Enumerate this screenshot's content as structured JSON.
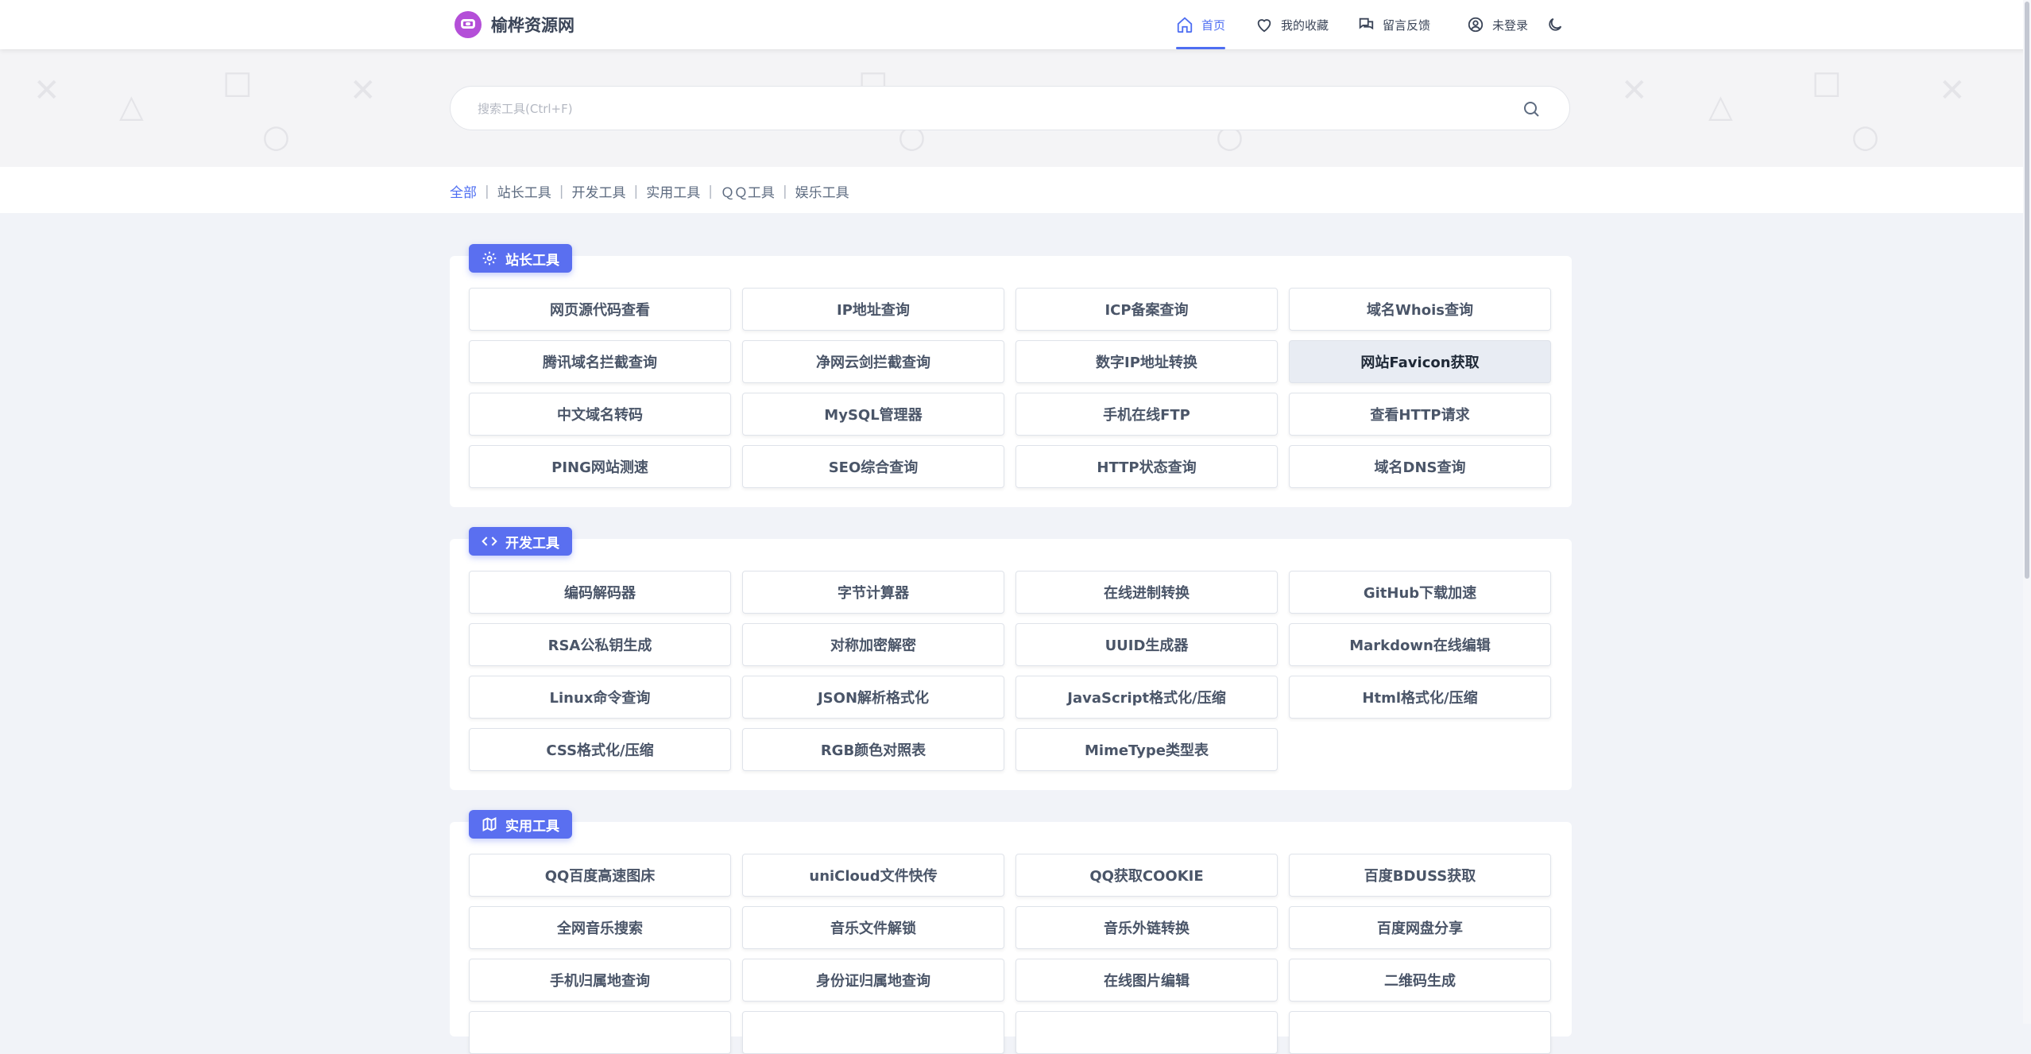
{
  "brand": {
    "name": "榆桦资源网",
    "logo_icon": "graduation-mask-icon"
  },
  "nav": {
    "home": "首页",
    "favorites": "我的收藏",
    "feedback": "留言反馈",
    "login": "未登录"
  },
  "search": {
    "placeholder": "搜索工具(Ctrl+F)"
  },
  "categories": {
    "all": "全部",
    "webmaster": "站长工具",
    "dev": "开发工具",
    "utility": "实用工具",
    "qq": "ＱＱ工具",
    "fun": "娱乐工具"
  },
  "sections": {
    "webmaster": {
      "title": "站长工具",
      "tools": [
        "网页源代码查看",
        "IP地址查询",
        "ICP备案查询",
        "域名Whois查询",
        "腾讯域名拦截查询",
        "净网云剑拦截查询",
        "数字IP地址转换",
        "网站Favicon获取",
        "中文域名转码",
        "MySQL管理器",
        "手机在线FTP",
        "查看HTTP请求",
        "PING网站测速",
        "SEO综合查询",
        "HTTP状态查询",
        "域名DNS查询"
      ]
    },
    "dev": {
      "title": "开发工具",
      "tools": [
        "编码解码器",
        "字节计算器",
        "在线进制转换",
        "GitHub下载加速",
        "RSA公私钥生成",
        "对称加密解密",
        "UUID生成器",
        "Markdown在线编辑",
        "Linux命令查询",
        "JSON解析格式化",
        "JavaScript格式化/压缩",
        "Html格式化/压缩",
        "CSS格式化/压缩",
        "RGB颜色对照表",
        "MimeType类型表"
      ]
    },
    "utility": {
      "title": "实用工具",
      "tools": [
        "QQ百度高速图床",
        "uniCloud文件快传",
        "QQ获取COOKIE",
        "百度BDUSS获取",
        "全网音乐搜索",
        "音乐文件解锁",
        "音乐外链转换",
        "百度网盘分享",
        "手机归属地查询",
        "身份证归属地查询",
        "在线图片编辑",
        "二维码生成"
      ]
    }
  },
  "colors": {
    "accent": "#4e6ef2",
    "tag_bg": "#5a6ff0",
    "brand_logo": "#b44fd8"
  }
}
